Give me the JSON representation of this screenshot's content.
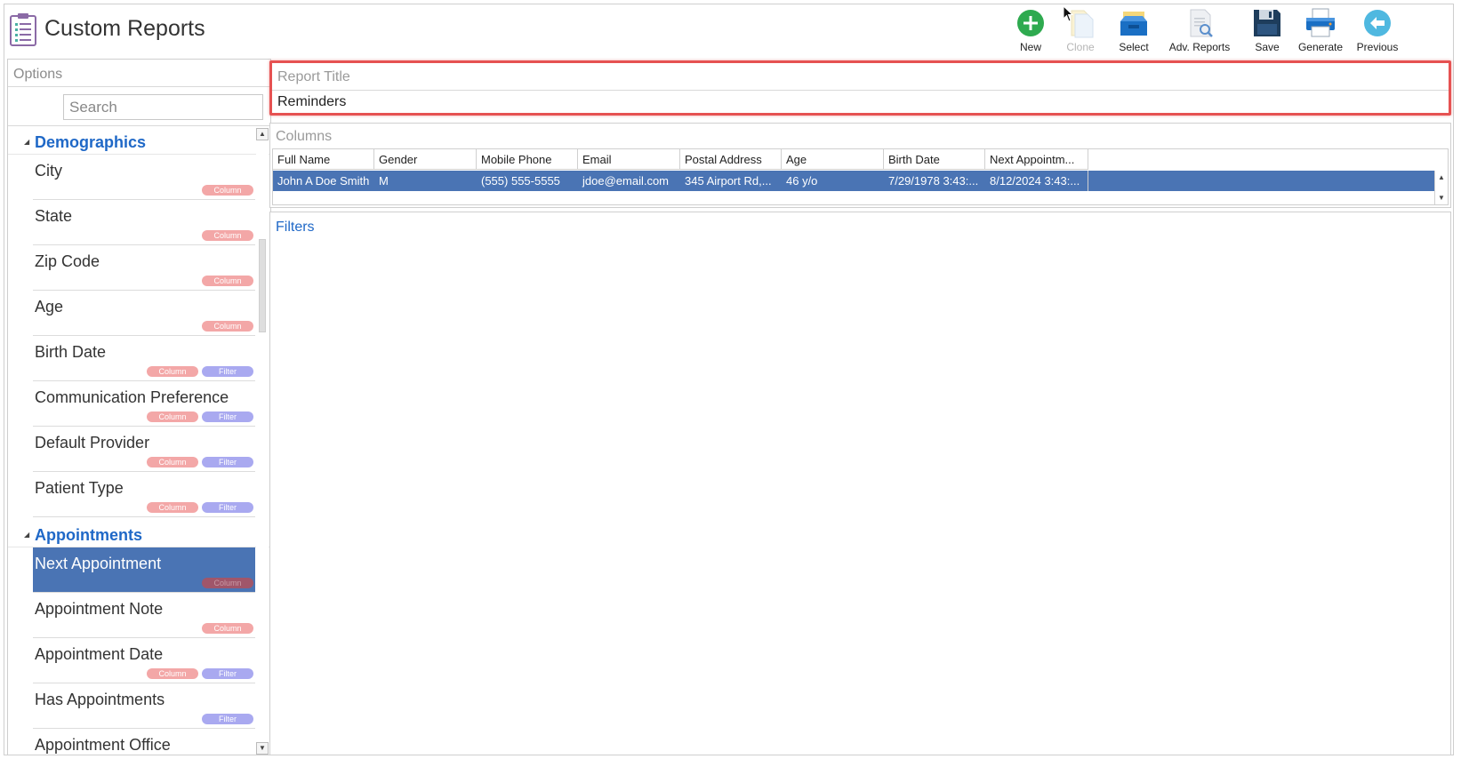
{
  "app": {
    "title": "Custom Reports"
  },
  "toolbar": {
    "buttons": [
      {
        "label": "New",
        "icon": "plus-circle-icon",
        "enabled": true
      },
      {
        "label": "Clone",
        "icon": "clone-document-icon",
        "enabled": false
      },
      {
        "label": "Select",
        "icon": "inbox-tray-icon",
        "enabled": true
      },
      {
        "label": "Adv. Reports",
        "icon": "document-search-icon",
        "enabled": true
      },
      {
        "label": "Save",
        "icon": "floppy-disk-icon",
        "enabled": true
      },
      {
        "label": "Generate",
        "icon": "printer-icon",
        "enabled": true
      },
      {
        "label": "Previous",
        "icon": "arrow-left-circle-icon",
        "enabled": true
      }
    ]
  },
  "options": {
    "header": "Options",
    "search_placeholder": "Search",
    "groups": [
      {
        "name": "Demographics",
        "items": [
          {
            "name": "City",
            "tags": [
              "Column"
            ]
          },
          {
            "name": "State",
            "tags": [
              "Column"
            ]
          },
          {
            "name": "Zip Code",
            "tags": [
              "Column"
            ]
          },
          {
            "name": "Age",
            "tags": [
              "Column"
            ]
          },
          {
            "name": "Birth Date",
            "tags": [
              "Column",
              "Filter"
            ]
          },
          {
            "name": "Communication Preference",
            "tags": [
              "Column",
              "Filter"
            ]
          },
          {
            "name": "Default Provider",
            "tags": [
              "Column",
              "Filter"
            ]
          },
          {
            "name": "Patient Type",
            "tags": [
              "Column",
              "Filter"
            ]
          }
        ]
      },
      {
        "name": "Appointments",
        "items": [
          {
            "name": "Next Appointment",
            "tags": [
              "Column"
            ],
            "selected": true
          },
          {
            "name": "Appointment Note",
            "tags": [
              "Column"
            ]
          },
          {
            "name": "Appointment Date",
            "tags": [
              "Column",
              "Filter"
            ]
          },
          {
            "name": "Has Appointments",
            "tags": [
              "Filter"
            ]
          },
          {
            "name": "Appointment Office",
            "tags": []
          }
        ]
      }
    ]
  },
  "report": {
    "title_label": "Report Title",
    "title_value": "Reminders"
  },
  "columns": {
    "label": "Columns",
    "headers": [
      "Full Name",
      "Gender",
      "Mobile Phone",
      "Email",
      "Postal Address",
      "Age",
      "Birth Date",
      "Next Appointm..."
    ],
    "row": [
      "John A Doe Smith",
      "M",
      "(555) 555-5555",
      "jdoe@email.com",
      "345 Airport Rd,...",
      "46 y/o",
      "7/29/1978 3:43:...",
      "8/12/2024 3:43:..."
    ]
  },
  "filters": {
    "label": "Filters"
  },
  "colors": {
    "accent_blue": "#1f68c7",
    "selection_blue": "#4a74b4",
    "highlight_red": "#e65252",
    "column_tag": "#f3a7a7",
    "filter_tag": "#a9a9f0"
  }
}
